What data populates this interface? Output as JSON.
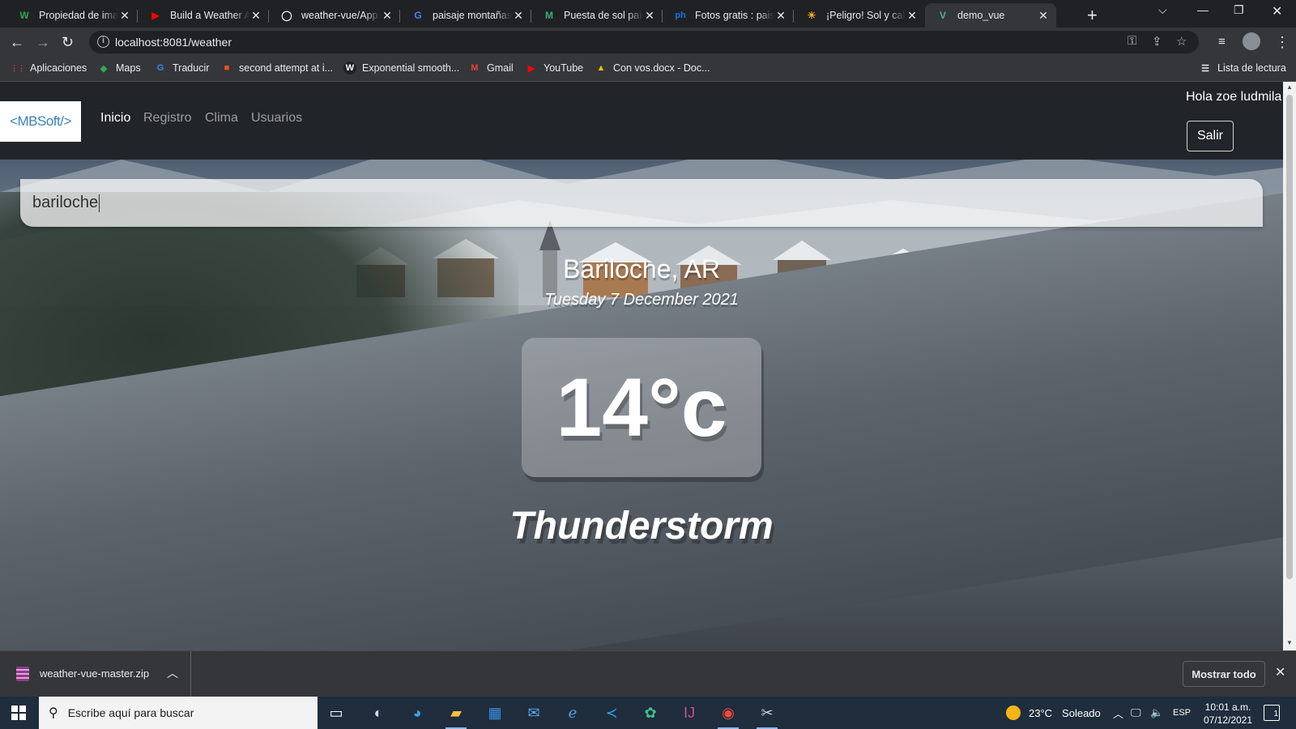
{
  "browser": {
    "tabs": [
      {
        "title": "Propiedad de imag",
        "favicon": "W",
        "favicon_color": "#2fa84f",
        "favicon_name": "wiki-icon"
      },
      {
        "title": "Build a Weather Ap",
        "favicon": "▶",
        "favicon_color": "#ff0000",
        "favicon_name": "youtube-icon"
      },
      {
        "title": "weather-vue/App.v",
        "favicon": "◯",
        "favicon_color": "#e8eaed",
        "favicon_name": "github-icon"
      },
      {
        "title": "paisaje montañas",
        "favicon": "G",
        "favicon_color": "#4285f4",
        "favicon_name": "google-icon"
      },
      {
        "title": "Puesta de sol paisa",
        "favicon": "M",
        "favicon_color": "#38b06e",
        "favicon_name": "site-icon"
      },
      {
        "title": "Fotos gratis : paisa",
        "favicon": "ph",
        "favicon_color": "#1a73e8",
        "favicon_name": "pixabay-icon"
      },
      {
        "title": "¡Peligro! Sol y calo",
        "favicon": "☀",
        "favicon_color": "#f2b01e",
        "favicon_name": "sun-site-icon"
      },
      {
        "title": "demo_vue",
        "favicon": "V",
        "favicon_color": "#41b883",
        "favicon_name": "vue-icon",
        "active": true
      }
    ],
    "url": "localhost:8081/weather",
    "bookmarks": [
      {
        "label": "Aplicaciones",
        "icon": "⋮⋮",
        "icon_color": "#ea4335"
      },
      {
        "label": "Maps",
        "icon": "◆",
        "icon_color": "#34a853"
      },
      {
        "label": "Traducir",
        "icon": "G",
        "icon_color": "#4285f4"
      },
      {
        "label": "second attempt at i...",
        "icon": "■",
        "icon_color": "#f25022"
      },
      {
        "label": "Exponential smooth...",
        "icon": "W",
        "icon_color": "#ffffff"
      },
      {
        "label": "Gmail",
        "icon": "M",
        "icon_color": "#ea4335"
      },
      {
        "label": "YouTube",
        "icon": "▶",
        "icon_color": "#ff0000"
      },
      {
        "label": "Con vos.docx - Doc...",
        "icon": "▲",
        "icon_color": "#fbbc04"
      }
    ],
    "reading_list": "Lista de lectura"
  },
  "app": {
    "brand": "<MBSoft/>",
    "nav": [
      "Inicio",
      "Registro",
      "Clima",
      "Usuarios"
    ],
    "active_nav": "Inicio",
    "greeting": "Hola zoe ludmila",
    "logout_label": "Salir",
    "search": {
      "value": "bariloche"
    },
    "location": "Bariloche, AR",
    "date": "Tuesday 7 December 2021",
    "temperature": "14°c",
    "weather": "Thunderstorm"
  },
  "downloads": {
    "file": "weather-vue-master.zip",
    "show_all": "Mostrar todo"
  },
  "taskbar": {
    "search_placeholder": "Escribe aquí para buscar",
    "weather_temp": "23°C",
    "weather_desc": "Soleado",
    "lang": "ESP",
    "time": "10:01 a.m.",
    "date": "07/12/2021",
    "notifications": "1"
  }
}
